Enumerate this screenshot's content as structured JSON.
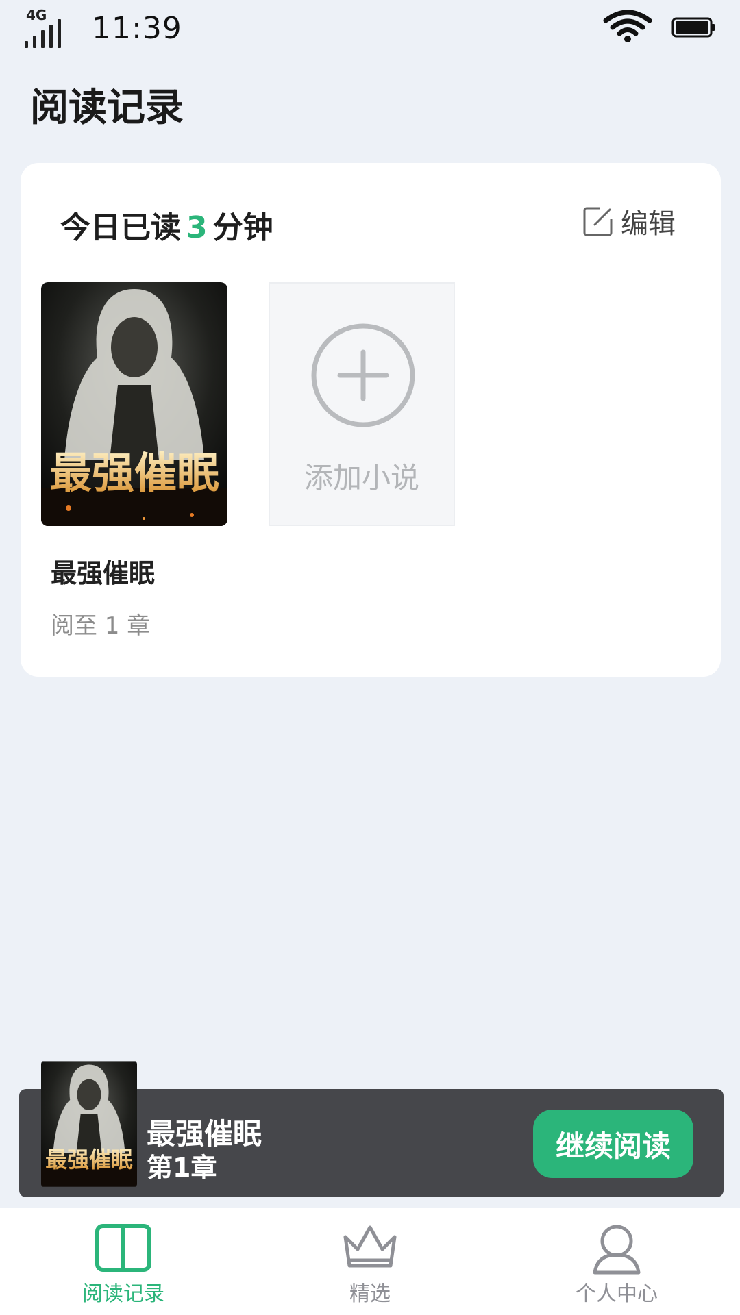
{
  "status_bar": {
    "network": "4G",
    "time": "11:39"
  },
  "header": {
    "title": "阅读记录"
  },
  "today": {
    "prefix": "今日已读",
    "minutes": "3",
    "suffix": "分钟",
    "edit_label": "编辑"
  },
  "books": [
    {
      "title": "最强催眠",
      "progress": "阅至 1 章",
      "cover_text": "最强催眠"
    }
  ],
  "add_novel": {
    "label": "添加小说"
  },
  "continue_bar": {
    "title": "最强催眠",
    "chapter": "第1章",
    "button": "继续阅读",
    "cover_text": "最强催眠"
  },
  "tabs": [
    {
      "label": "阅读记录",
      "icon": "book-icon",
      "active": true
    },
    {
      "label": "精选",
      "icon": "crown-icon",
      "active": false
    },
    {
      "label": "个人中心",
      "icon": "user-icon",
      "active": false
    }
  ],
  "colors": {
    "accent": "#2bb57a",
    "background": "#edf1f7",
    "continue_bar": "#46474b"
  }
}
